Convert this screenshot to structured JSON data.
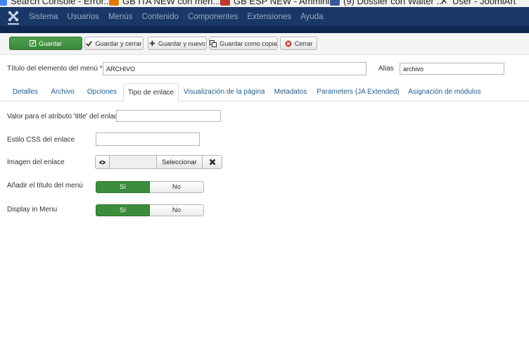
{
  "browser": {
    "bookmarks": [
      {
        "label": "Search Console - Error...",
        "color": "#4285f4"
      },
      {
        "label": "GB ITA NEW con men...",
        "color": "#e07b00"
      },
      {
        "label": "GB ESP NEW - Ammini...",
        "color": "#c0392b"
      },
      {
        "label": "(9) Dossier con Walter ...",
        "color": "#3b5998"
      },
      {
        "label": "User - JoomlArt",
        "color": "#222222"
      }
    ]
  },
  "navbar": {
    "items": [
      "Sistema",
      "Usuarios",
      "Menús",
      "Contenido",
      "Componentes",
      "Extensiones",
      "Ayuda"
    ]
  },
  "toolbar": {
    "save": "Guardar",
    "save_close": "Guardar y cerrar",
    "save_new": "Guardar y nuevo",
    "save_copy": "Guardar como copia",
    "close": "Cerrar"
  },
  "header": {
    "title_label": "Título del elemento del menú *",
    "title_value": "ARCHIVO",
    "alias_label": "Alias",
    "alias_value": "archivo"
  },
  "tabs": [
    {
      "label": "Detalles",
      "active": false
    },
    {
      "label": "Archivo",
      "active": false
    },
    {
      "label": "Opciones",
      "active": false
    },
    {
      "label": "Tipo de enlace",
      "active": true
    },
    {
      "label": "Visualización de la página",
      "active": false
    },
    {
      "label": "Metadatos",
      "active": false
    },
    {
      "label": "Parameters (JA Extended)",
      "active": false
    },
    {
      "label": "Asignación de módulos",
      "active": false
    }
  ],
  "form": {
    "title_attr_label": "Valor para el atributo 'title' del enlace",
    "title_attr_value": "",
    "css_label": "Estilo CSS del enlace",
    "css_value": "",
    "image_label": "Imagen del enlace",
    "image_select": "Seleccionar",
    "add_title_label": "Añadir el título del menú",
    "display_label": "Display in Menu",
    "yes": "Sí",
    "no": "No"
  },
  "colors": {
    "navbar": "#1a3867",
    "primary_green": "#3c8c3c",
    "tab_link": "#1f5c8f"
  }
}
